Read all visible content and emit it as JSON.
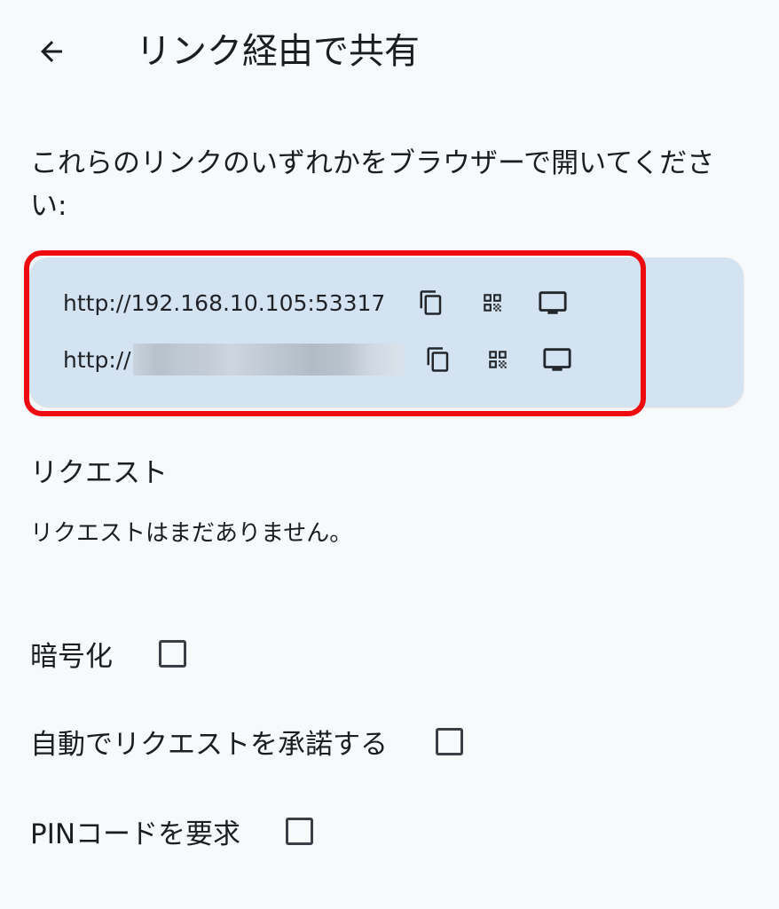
{
  "header": {
    "title": "リンク経由で共有",
    "back_icon": "arrow-left-icon"
  },
  "instructions": "これらのリンクのいずれかをブラウザーで開いてください:",
  "links": [
    {
      "url": "http://192.168.10.105:53317",
      "actions": [
        "copy-icon",
        "qr-code-icon",
        "display-icon"
      ]
    },
    {
      "url": "http://",
      "url_redacted": true,
      "actions": [
        "copy-icon",
        "qr-code-icon",
        "display-icon"
      ]
    }
  ],
  "requests": {
    "title": "リクエスト",
    "empty_message": "リクエストはまだありません。"
  },
  "options": [
    {
      "label": "暗号化",
      "checked": false
    },
    {
      "label": "自動でリクエストを承諾する",
      "checked": false
    },
    {
      "label": "PINコードを要求",
      "checked": false
    }
  ],
  "colors": {
    "card_background": "#d3e3f1",
    "highlight_border": "#ee0b10",
    "page_background": "#f8f9fb"
  }
}
